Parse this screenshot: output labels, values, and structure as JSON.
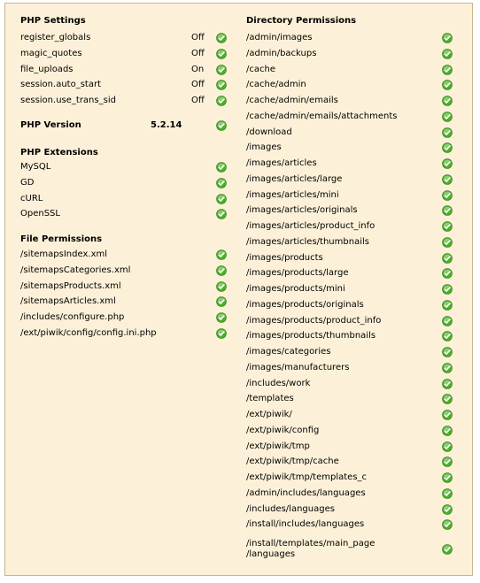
{
  "php_settings": {
    "heading": "PHP Settings",
    "items": [
      {
        "label": "register_globals",
        "value": "Off",
        "icon": "check-ok-icon"
      },
      {
        "label": "magic_quotes",
        "value": "Off",
        "icon": "check-ok-icon"
      },
      {
        "label": "file_uploads",
        "value": "On",
        "icon": "check-ok-icon"
      },
      {
        "label": "session.auto_start",
        "value": "Off",
        "icon": "check-ok-icon"
      },
      {
        "label": "session.use_trans_sid",
        "value": "Off",
        "icon": "check-ok-icon"
      }
    ]
  },
  "php_version": {
    "label": "PHP Version",
    "value": "5.2.14",
    "icon": "check-ok-icon"
  },
  "php_extensions": {
    "heading": "PHP Extensions",
    "items": [
      "MySQL",
      "GD",
      "cURL",
      "OpenSSL"
    ]
  },
  "file_permissions": {
    "heading": "File Permissions",
    "items": [
      "/sitemapsIndex.xml",
      "/sitemapsCategories.xml",
      "/sitemapsProducts.xml",
      "/sitemapsArticles.xml",
      "/includes/configure.php",
      "/ext/piwik/config/config.ini.php"
    ]
  },
  "directory_permissions": {
    "heading": "Directory Permissions",
    "items": [
      "/admin/images",
      "/admin/backups",
      "/cache",
      "/cache/admin",
      "/cache/admin/emails",
      "/cache/admin/emails/attachments",
      "/download",
      "/images",
      "/images/articles",
      "/images/articles/large",
      "/images/articles/mini",
      "/images/articles/originals",
      "/images/articles/product_info",
      "/images/articles/thumbnails",
      "/images/products",
      "/images/products/large",
      "/images/products/mini",
      "/images/products/originals",
      "/images/products/product_info",
      "/images/products/thumbnails",
      "/images/categories",
      "/images/manufacturers",
      "/includes/work",
      "/templates",
      "/ext/piwik/",
      "/ext/piwik/config",
      "/ext/piwik/tmp",
      "/ext/piwik/tmp/cache",
      "/ext/piwik/tmp/templates_c",
      "/admin/includes/languages",
      "/includes/languages",
      "/install/includes/languages",
      "/install/templates/main_page\n/languages"
    ]
  },
  "colors": {
    "panel_bg": "#fcf1d8",
    "panel_border": "#c8b68e",
    "ok_green": "#4caf28"
  }
}
